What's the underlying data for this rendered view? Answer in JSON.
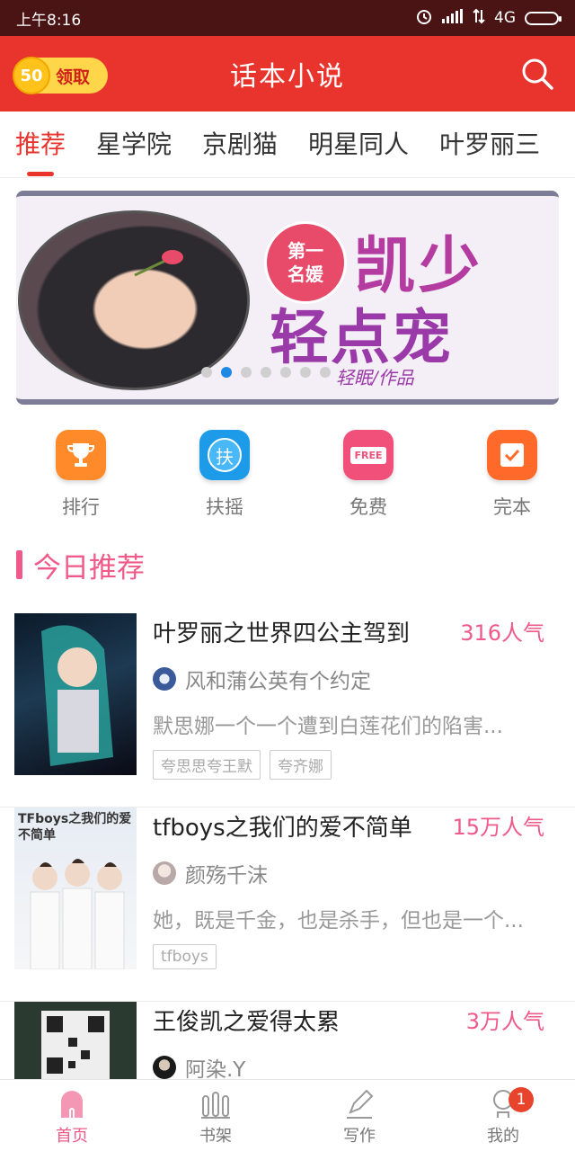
{
  "status_bar": {
    "time": "上午8:16",
    "network": "4G"
  },
  "header": {
    "coin_amount": "50",
    "claim_label": "领取",
    "title": "话本小说"
  },
  "tabs": [
    {
      "label": "推荐",
      "active": true
    },
    {
      "label": "星学院",
      "active": false
    },
    {
      "label": "京剧猫",
      "active": false
    },
    {
      "label": "明星同人",
      "active": false
    },
    {
      "label": "叶罗丽三",
      "active": false
    }
  ],
  "banner": {
    "badge_line1": "第一",
    "badge_line2": "名媛",
    "title_line1": "凯少",
    "title_line2": "轻点宠",
    "author": "轻眠/作品",
    "slide_count": 7,
    "active_slide": 1
  },
  "quick_menu": [
    {
      "label": "排行",
      "icon": "trophy-icon",
      "color": "#ff8a2a"
    },
    {
      "label": "扶摇",
      "icon": "fuyao-icon",
      "icon_text": "扶",
      "color": "#1e9be8"
    },
    {
      "label": "免费",
      "icon": "free-icon",
      "icon_text": "FREE",
      "color": "#f0507a"
    },
    {
      "label": "完本",
      "icon": "check-icon",
      "color": "#ff6a2a"
    }
  ],
  "section": {
    "title": "今日推荐"
  },
  "books": [
    {
      "title": "叶罗丽之世界四公主驾到",
      "popularity": "316人气",
      "author": "风和蒲公英有个约定",
      "summary": "默思娜一个一个遭到白莲花们的陷害...",
      "tags": [
        "夸思思夸王默",
        "夸齐娜"
      ]
    },
    {
      "title": "tfboys之我们的爱不简单",
      "popularity": "15万人气",
      "author": "颜殇千沫",
      "summary": "她，既是千金，也是杀手，但也是一个...",
      "tags": [
        "tfboys"
      ],
      "cover_text": "TFboys之我们的爱不简单"
    },
    {
      "title": "王俊凯之爱得太累",
      "popularity": "3万人气",
      "author": "阿染.Y",
      "summary": "",
      "tags": []
    }
  ],
  "bottom_nav": [
    {
      "label": "首页",
      "active": true
    },
    {
      "label": "书架",
      "active": false
    },
    {
      "label": "写作",
      "active": false
    },
    {
      "label": "我的",
      "active": false,
      "badge": "1"
    }
  ],
  "colors": {
    "brand_red": "#e8342c",
    "accent_pink": "#ef5a8a"
  }
}
